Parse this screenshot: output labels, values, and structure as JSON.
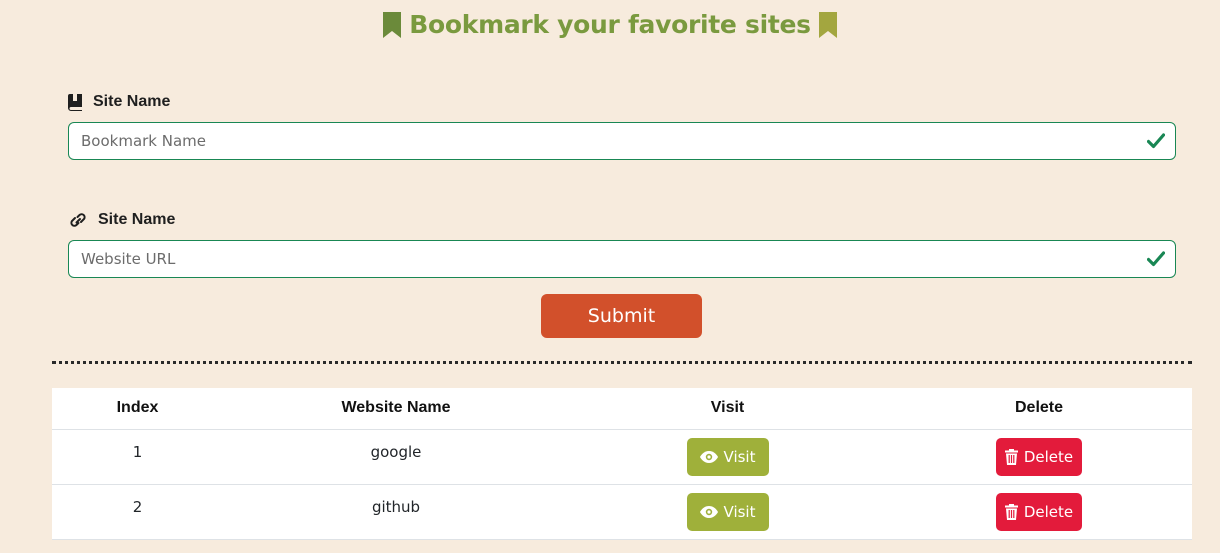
{
  "header": {
    "title": "Bookmark your favorite sites",
    "left_icon": "bookmark-icon",
    "right_icon": "bookmark-icon"
  },
  "form": {
    "name_field": {
      "label": "Site Name",
      "icon": "book-icon",
      "placeholder": "Bookmark Name",
      "value": ""
    },
    "url_field": {
      "label": "Site Name",
      "icon": "link-icon",
      "placeholder": "Website URL",
      "value": ""
    },
    "submit_label": "Submit"
  },
  "table": {
    "headers": {
      "index": "Index",
      "name": "Website Name",
      "visit": "Visit",
      "delete": "Delete"
    },
    "rows": [
      {
        "index": "1",
        "name": "google",
        "visit_label": "Visit",
        "delete_label": "Delete"
      },
      {
        "index": "2",
        "name": "github",
        "visit_label": "Visit",
        "delete_label": "Delete"
      }
    ]
  },
  "colors": {
    "background": "#f7ebdd",
    "title_green": "#7a9a3f",
    "valid_border": "#198754",
    "submit": "#d2502b",
    "visit": "#9fb03a",
    "delete": "#e31b3b"
  }
}
